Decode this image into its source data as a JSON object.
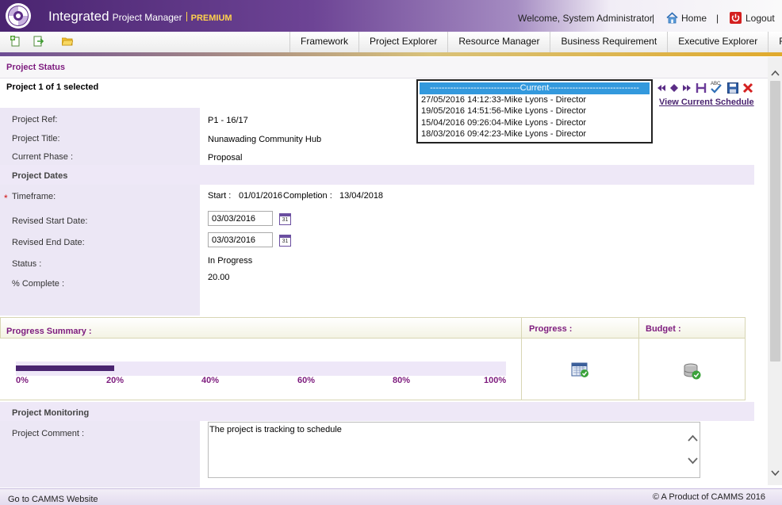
{
  "header": {
    "brand_integrated": "Integrated",
    "brand_pm": "Project Manager",
    "brand_premium": "PREMIUM",
    "welcome": "Welcome, System Administrator",
    "home": "Home",
    "logout": "Logout",
    "separator": "|"
  },
  "toolbar_icons": [
    "new-page-icon",
    "export-icon",
    "open-folder-icon"
  ],
  "nav": [
    {
      "label": "Framework"
    },
    {
      "label": "Project Explorer"
    },
    {
      "label": "Resource Manager"
    },
    {
      "label": "Business Requirement"
    },
    {
      "label": "Executive Explorer"
    },
    {
      "label": "Reports"
    }
  ],
  "project_status": {
    "title": "Project Status",
    "selected": "Project 1 of 1 selected"
  },
  "history": {
    "items": [
      "-------------------------------Current-------------------------------",
      "27/05/2016 14:12:33-Mike Lyons - Director",
      "19/05/2016 14:51:56-Mike Lyons - Director",
      "15/04/2016 09:26:04-Mike Lyons - Director",
      "18/03/2016 09:42:23-Mike Lyons - Director"
    ],
    "view_current": "View Current Schedule"
  },
  "form": {
    "project_ref_label": "Project Ref:",
    "project_ref": "P1 - 16/17",
    "project_title_label": "Project Title:",
    "project_title": "Nunawading Community Hub",
    "current_phase_label": "Current Phase :",
    "current_phase": "Proposal",
    "project_dates": "Project Dates",
    "timeframe_label": "Timeframe:",
    "timeframe_start_label": "Start :",
    "timeframe_start": "01/01/2016",
    "timeframe_completion_label": "Completion :",
    "timeframe_completion": "13/04/2018",
    "revised_start_label": "Revised Start Date:",
    "revised_start": "03/03/2016",
    "revised_end_label": "Revised End Date:",
    "revised_end": "03/03/2016",
    "calendar_text": "31",
    "status_label": "Status :",
    "status": "In Progress",
    "pct_complete_label": "% Complete :",
    "pct_complete": "20.00",
    "required_mark": "*"
  },
  "progress_summary": {
    "title": "Progress Summary :",
    "progress_header": "Progress :",
    "budget_header": "Budget :",
    "ticks": [
      "0%",
      "20%",
      "40%",
      "60%",
      "80%",
      "100%"
    ],
    "percent_complete": 20
  },
  "monitoring": {
    "title": "Project Monitoring",
    "comment_label": "Project Comment :",
    "comment": "The project is tracking to schedule"
  },
  "footer": {
    "link": "Go to CAMMS Website",
    "copyright": "© A Product of CAMMS 2016"
  }
}
